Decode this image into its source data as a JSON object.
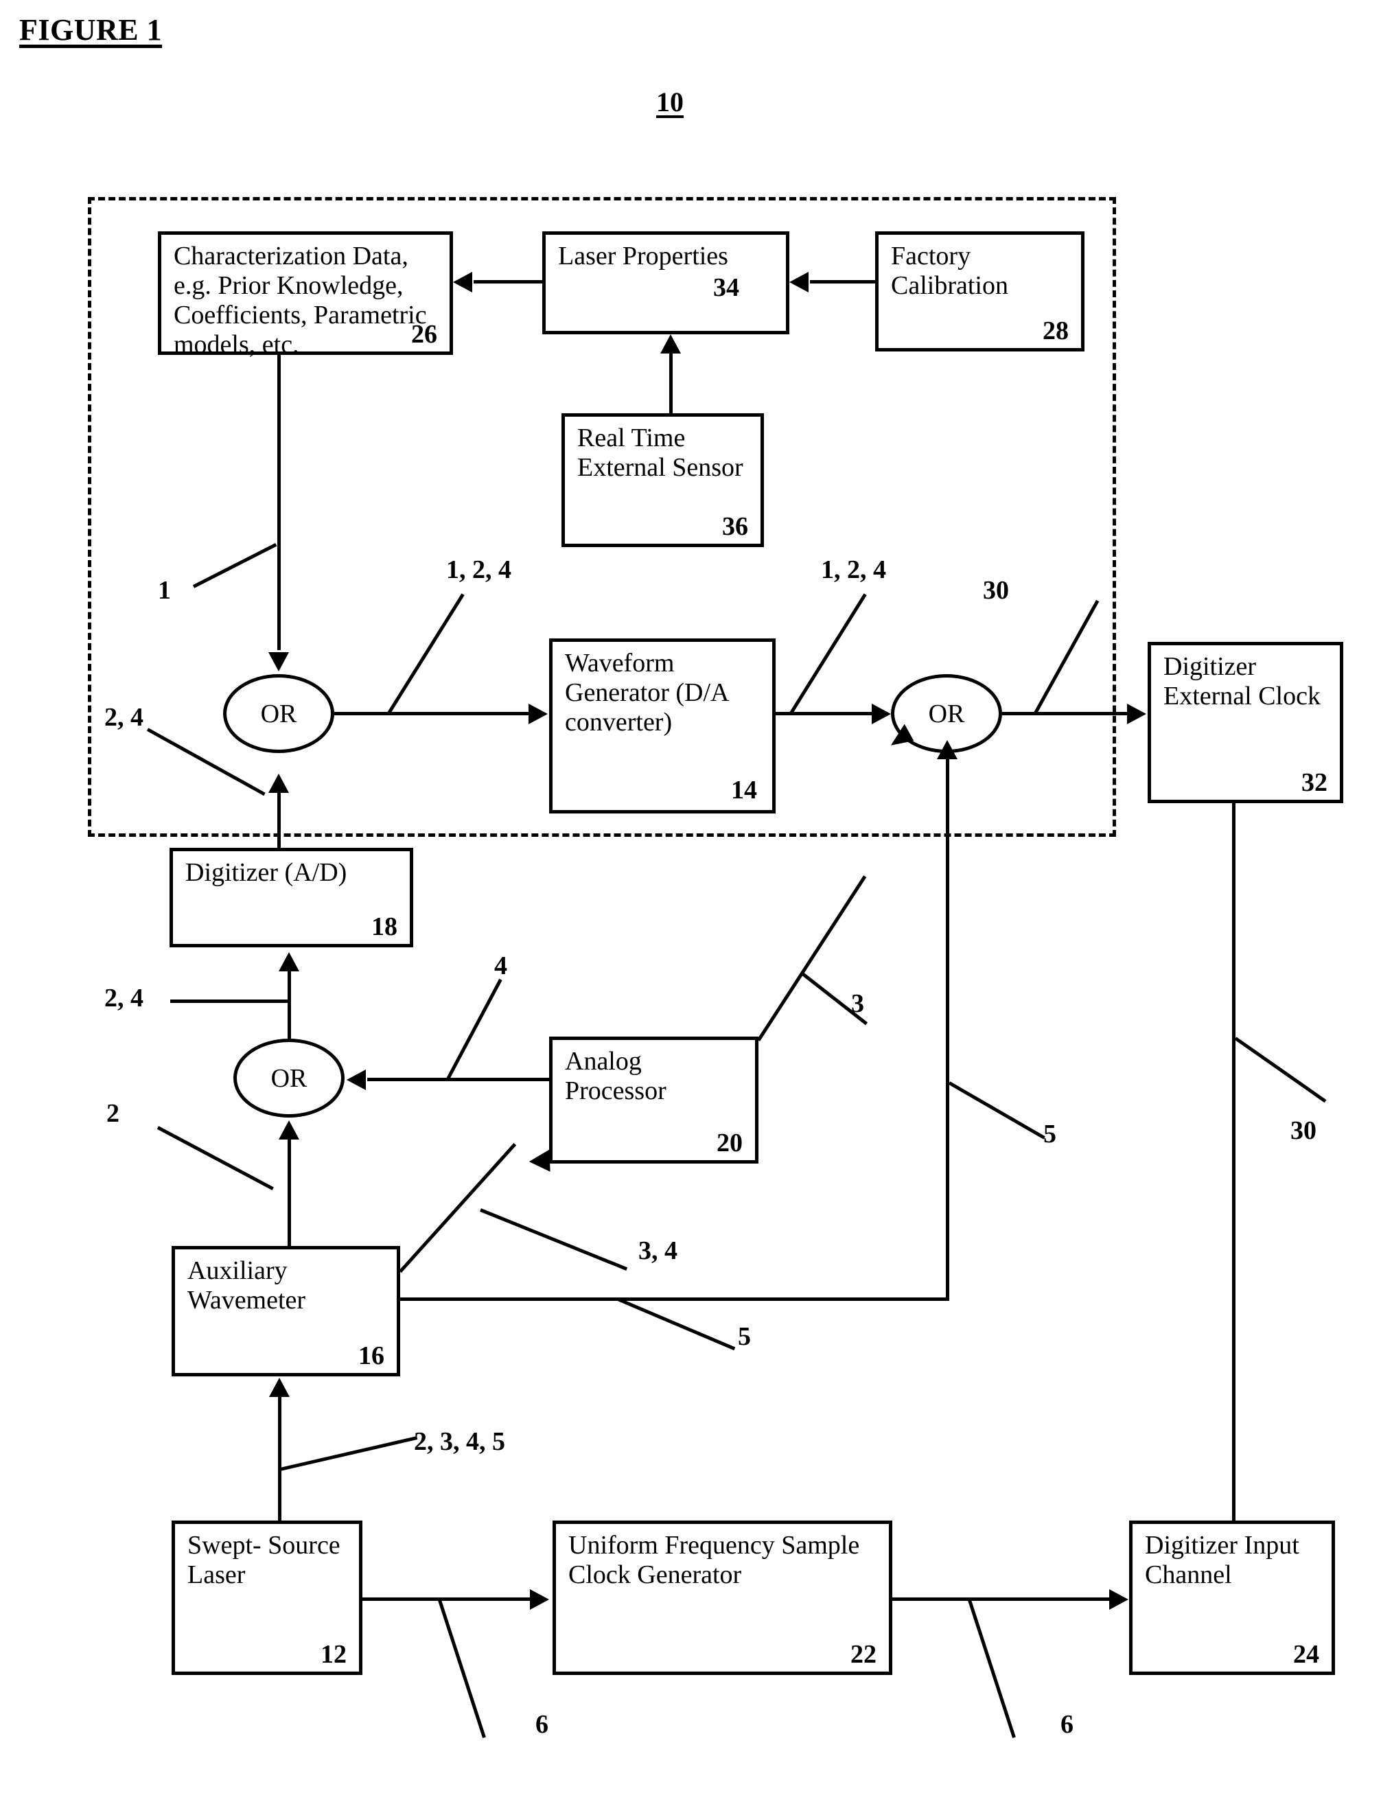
{
  "figure": {
    "title": "FIGURE 1",
    "system_reference_number": "10"
  },
  "boundary": {
    "style": "dashed",
    "name": "system-boundary"
  },
  "blocks": [
    {
      "id": "characterization-data",
      "label": "Characterization Data, e.g. Prior Knowledge, Coefficients, Parametric models, etc.",
      "ref": "26"
    },
    {
      "id": "laser-properties",
      "label": "Laser Properties",
      "ref": "34"
    },
    {
      "id": "factory-calibration",
      "label": "Factory Calibration",
      "ref": "28"
    },
    {
      "id": "real-time-external-sensor",
      "label": "Real Time External Sensor",
      "ref": "36"
    },
    {
      "id": "waveform-generator",
      "label": "Waveform Generator (D/A converter)",
      "ref": "14"
    },
    {
      "id": "digitizer-external-clock",
      "label": "Digitizer External Clock",
      "ref": "32"
    },
    {
      "id": "digitizer-ad",
      "label": "Digitizer (A/D)",
      "ref": "18"
    },
    {
      "id": "analog-processor",
      "label": "Analog Processor",
      "ref": "20"
    },
    {
      "id": "auxiliary-wavemeter",
      "label": "Auxiliary Wavemeter",
      "ref": "16"
    },
    {
      "id": "swept-source-laser",
      "label": "Swept- Source Laser",
      "ref": "12"
    },
    {
      "id": "uniform-frequency-sample-clock-generator",
      "label": "Uniform Frequency Sample Clock Generator",
      "ref": "22"
    },
    {
      "id": "digitizer-input-channel",
      "label": "Digitizer Input Channel",
      "ref": "24"
    }
  ],
  "gates": [
    {
      "id": "or-gate-top",
      "label": "OR"
    },
    {
      "id": "or-gate-right",
      "label": "OR"
    },
    {
      "id": "or-gate-left-lower",
      "label": "OR"
    }
  ],
  "signal_labels": {
    "char_to_or_top": "1",
    "or_top_to_waveform": "1, 2, 4",
    "digitizer_to_or_top": "2, 4",
    "or_lower_to_digitizer": "2, 4",
    "wavemeter_to_or_lower": "2",
    "analog_to_or_lower": "4",
    "waveform_to_or_right": "1, 2, 4",
    "or_right_to_ext_clock": "30",
    "analog_to_or_right": "3",
    "wavemeter_to_analog": "3, 4",
    "wavemeter_to_or_right": "5",
    "or_right_branch_5": "5",
    "ext_clock_down": "30",
    "laser_to_wavemeter": "2, 3, 4, 5",
    "laser_to_clockgen": "6",
    "clockgen_to_input": "6"
  }
}
